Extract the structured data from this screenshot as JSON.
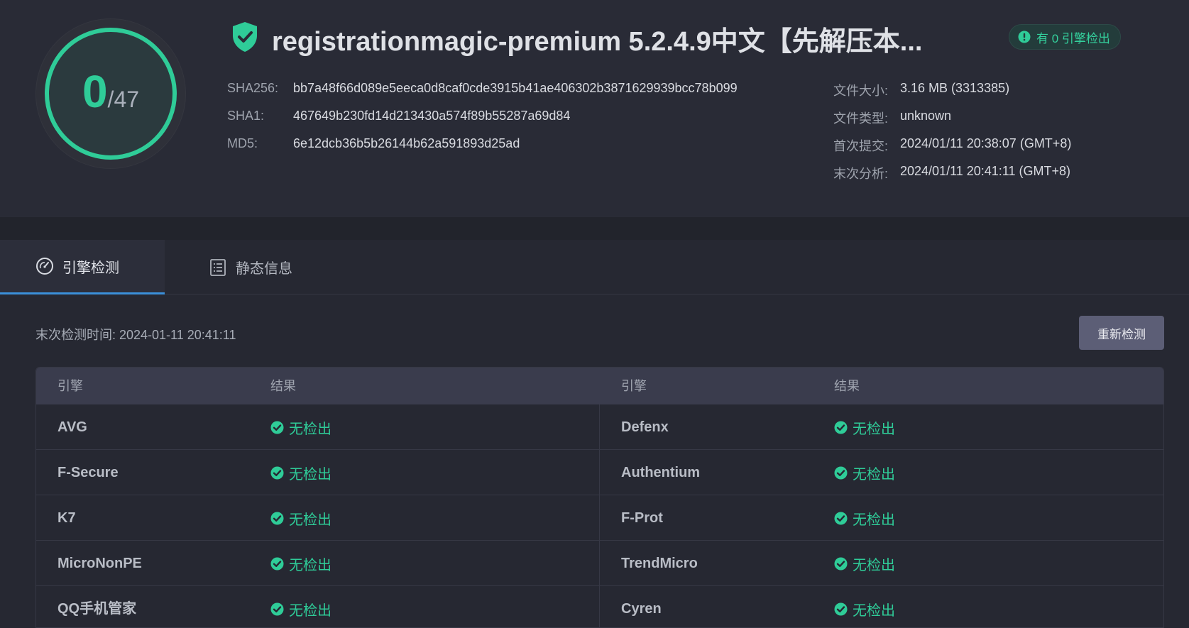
{
  "summary": {
    "detected": "0",
    "total": "/47",
    "title": "registrationmagic-premium 5.2.4.9中文【先解压本...",
    "badge_text": "有 0 引擎检出"
  },
  "hashes": [
    {
      "label": "SHA256:",
      "value": "bb7a48f66d089e5eeca0d8caf0cde3915b41ae406302b3871629939bcc78b099"
    },
    {
      "label": "SHA1:",
      "value": "467649b230fd14d213430a574f89b55287a69d84"
    },
    {
      "label": "MD5:",
      "value": "6e12dcb36b5b26144b62a591893d25ad"
    }
  ],
  "file_info": [
    {
      "label": "文件大小:",
      "value": "3.16 MB (3313385)"
    },
    {
      "label": "文件类型:",
      "value": "unknown"
    },
    {
      "label": "首次提交:",
      "value": "2024/01/11 20:38:07 (GMT+8)"
    },
    {
      "label": "末次分析:",
      "value": "2024/01/11 20:41:11 (GMT+8)"
    }
  ],
  "tabs": [
    {
      "label": "引擎检测",
      "icon": "gauge-icon",
      "active": true
    },
    {
      "label": "静态信息",
      "icon": "list-icon",
      "active": false
    }
  ],
  "scan": {
    "last_scan": "末次检测时间: 2024-01-11 20:41:11",
    "rescan_label": "重新检测"
  },
  "table": {
    "headers": [
      "引擎",
      "结果",
      "引擎",
      "结果"
    ],
    "rows": [
      {
        "left_engine": "AVG",
        "left_result": "无检出",
        "right_engine": "Defenx",
        "right_result": "无检出"
      },
      {
        "left_engine": "F-Secure",
        "left_result": "无检出",
        "right_engine": "Authentium",
        "right_result": "无检出"
      },
      {
        "left_engine": "K7",
        "left_result": "无检出",
        "right_engine": "F-Prot",
        "right_result": "无检出"
      },
      {
        "left_engine": "MicroNonPE",
        "left_result": "无检出",
        "right_engine": "TrendMicro",
        "right_result": "无检出"
      },
      {
        "left_engine": "QQ手机管家",
        "left_result": "无检出",
        "right_engine": "Cyren",
        "right_result": "无检出"
      }
    ]
  },
  "colors": {
    "accent_green": "#2fcc98",
    "tab_underline": "#3b8fd9",
    "background": "#262832"
  }
}
